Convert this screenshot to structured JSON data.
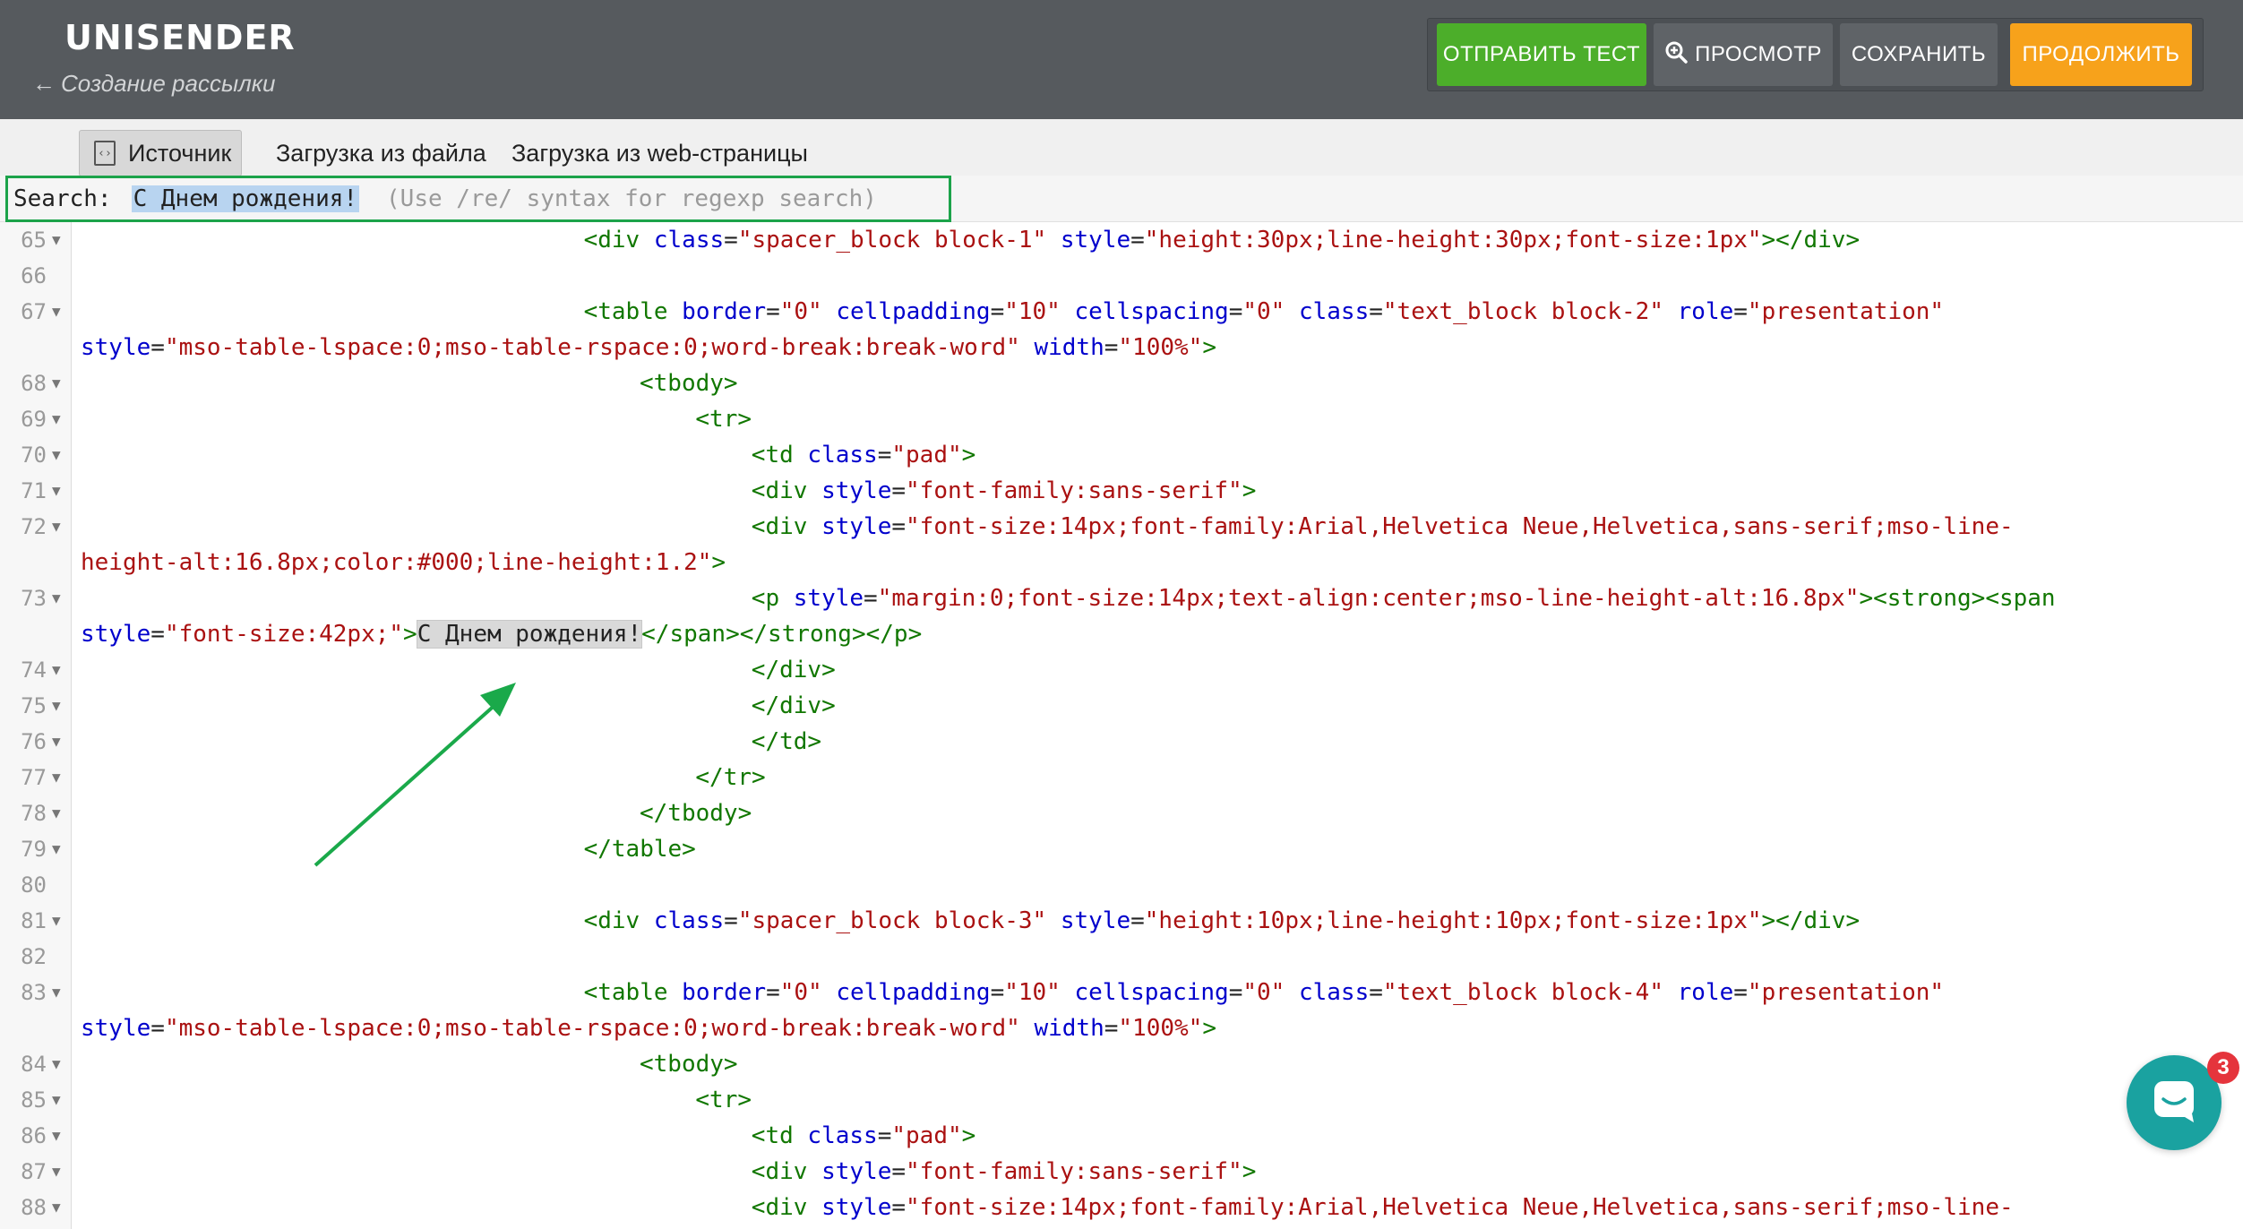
{
  "header": {
    "logo": "UNISENDER",
    "back_arrow": "←",
    "back_label": "Создание рассылки",
    "buttons": {
      "send_test": "ОТПРАВИТЬ ТЕСТ",
      "preview": "ПРОСМОТР",
      "save": "СОХРАНИТЬ",
      "continue": "ПРОДОЛЖИТЬ"
    }
  },
  "tabs": {
    "source": "Источник",
    "from_file": "Загрузка из файла",
    "from_web": "Загрузка из web-страницы"
  },
  "search": {
    "label": "Search:",
    "value": "С Днем рождения!",
    "hint": "(Use /re/ syntax for regexp search)"
  },
  "editor": {
    "lines": [
      {
        "n": "65",
        "fold": true,
        "indent": 36,
        "tokens": [
          [
            "tg",
            "<div "
          ],
          [
            "at",
            "class"
          ],
          [
            "pl",
            "="
          ],
          [
            "st",
            "\"spacer_block block-1\""
          ],
          [
            "pl",
            " "
          ],
          [
            "at",
            "style"
          ],
          [
            "pl",
            "="
          ],
          [
            "st",
            "\"height:30px;line-height:30px;font-size:1px\""
          ],
          [
            "tg",
            "></div>"
          ]
        ]
      },
      {
        "n": "66",
        "fold": false,
        "indent": 0,
        "tokens": []
      },
      {
        "n": "67",
        "fold": true,
        "indent": 36,
        "tokens": [
          [
            "tg",
            "<table "
          ],
          [
            "at",
            "border"
          ],
          [
            "pl",
            "="
          ],
          [
            "st",
            "\"0\""
          ],
          [
            "pl",
            " "
          ],
          [
            "at",
            "cellpadding"
          ],
          [
            "pl",
            "="
          ],
          [
            "st",
            "\"10\""
          ],
          [
            "pl",
            " "
          ],
          [
            "at",
            "cellspacing"
          ],
          [
            "pl",
            "="
          ],
          [
            "st",
            "\"0\""
          ],
          [
            "pl",
            " "
          ],
          [
            "at",
            "class"
          ],
          [
            "pl",
            "="
          ],
          [
            "st",
            "\"text_block block-2\""
          ],
          [
            "pl",
            " "
          ],
          [
            "at",
            "role"
          ],
          [
            "pl",
            "="
          ],
          [
            "st",
            "\"presentation\""
          ]
        ]
      },
      {
        "n": "",
        "fold": false,
        "indent": 0,
        "tokens": [
          [
            "at",
            "style"
          ],
          [
            "pl",
            "="
          ],
          [
            "st",
            "\"mso-table-lspace:0;mso-table-rspace:0;word-break:break-word\""
          ],
          [
            "pl",
            " "
          ],
          [
            "at",
            "width"
          ],
          [
            "pl",
            "="
          ],
          [
            "st",
            "\"100%\""
          ],
          [
            "tg",
            ">"
          ]
        ]
      },
      {
        "n": "68",
        "fold": true,
        "indent": 40,
        "tokens": [
          [
            "tg",
            "<tbody>"
          ]
        ]
      },
      {
        "n": "69",
        "fold": true,
        "indent": 44,
        "tokens": [
          [
            "tg",
            "<tr>"
          ]
        ]
      },
      {
        "n": "70",
        "fold": true,
        "indent": 48,
        "tokens": [
          [
            "tg",
            "<td "
          ],
          [
            "at",
            "class"
          ],
          [
            "pl",
            "="
          ],
          [
            "st",
            "\"pad\""
          ],
          [
            "tg",
            ">"
          ]
        ]
      },
      {
        "n": "71",
        "fold": true,
        "indent": 48,
        "tokens": [
          [
            "tg",
            "<div "
          ],
          [
            "at",
            "style"
          ],
          [
            "pl",
            "="
          ],
          [
            "st",
            "\"font-family:sans-serif\""
          ],
          [
            "tg",
            ">"
          ]
        ]
      },
      {
        "n": "72",
        "fold": true,
        "indent": 48,
        "tokens": [
          [
            "tg",
            "<div "
          ],
          [
            "at",
            "style"
          ],
          [
            "pl",
            "="
          ],
          [
            "st",
            "\"font-size:14px;font-family:Arial,Helvetica Neue,Helvetica,sans-serif;mso-line-"
          ]
        ]
      },
      {
        "n": "",
        "fold": false,
        "indent": 0,
        "tokens": [
          [
            "st",
            "height-alt:16.8px;color:#000;line-height:1.2\""
          ],
          [
            "tg",
            ">"
          ]
        ]
      },
      {
        "n": "73",
        "fold": true,
        "indent": 48,
        "tokens": [
          [
            "tg",
            "<p "
          ],
          [
            "at",
            "style"
          ],
          [
            "pl",
            "="
          ],
          [
            "st",
            "\"margin:0;font-size:14px;text-align:center;mso-line-height-alt:16.8px\""
          ],
          [
            "tg",
            "><strong><span"
          ]
        ]
      },
      {
        "n": "",
        "fold": false,
        "indent": 0,
        "tokens": [
          [
            "at",
            "style"
          ],
          [
            "pl",
            "="
          ],
          [
            "st",
            "\"font-size:42px;\""
          ],
          [
            "tg",
            ">"
          ],
          [
            "hl",
            "С Днем рождения!"
          ],
          [
            "tg",
            "</span></strong></p>"
          ]
        ]
      },
      {
        "n": "74",
        "fold": true,
        "indent": 48,
        "tokens": [
          [
            "tg",
            "</div>"
          ]
        ]
      },
      {
        "n": "75",
        "fold": true,
        "indent": 48,
        "tokens": [
          [
            "tg",
            "</div>"
          ]
        ]
      },
      {
        "n": "76",
        "fold": true,
        "indent": 48,
        "tokens": [
          [
            "tg",
            "</td>"
          ]
        ]
      },
      {
        "n": "77",
        "fold": true,
        "indent": 44,
        "tokens": [
          [
            "tg",
            "</tr>"
          ]
        ]
      },
      {
        "n": "78",
        "fold": true,
        "indent": 40,
        "tokens": [
          [
            "tg",
            "</tbody>"
          ]
        ]
      },
      {
        "n": "79",
        "fold": true,
        "indent": 36,
        "tokens": [
          [
            "tg",
            "</table>"
          ]
        ]
      },
      {
        "n": "80",
        "fold": false,
        "indent": 0,
        "tokens": []
      },
      {
        "n": "81",
        "fold": true,
        "indent": 36,
        "tokens": [
          [
            "tg",
            "<div "
          ],
          [
            "at",
            "class"
          ],
          [
            "pl",
            "="
          ],
          [
            "st",
            "\"spacer_block block-3\""
          ],
          [
            "pl",
            " "
          ],
          [
            "at",
            "style"
          ],
          [
            "pl",
            "="
          ],
          [
            "st",
            "\"height:10px;line-height:10px;font-size:1px\""
          ],
          [
            "tg",
            "></div>"
          ]
        ]
      },
      {
        "n": "82",
        "fold": false,
        "indent": 0,
        "tokens": []
      },
      {
        "n": "83",
        "fold": true,
        "indent": 36,
        "tokens": [
          [
            "tg",
            "<table "
          ],
          [
            "at",
            "border"
          ],
          [
            "pl",
            "="
          ],
          [
            "st",
            "\"0\""
          ],
          [
            "pl",
            " "
          ],
          [
            "at",
            "cellpadding"
          ],
          [
            "pl",
            "="
          ],
          [
            "st",
            "\"10\""
          ],
          [
            "pl",
            " "
          ],
          [
            "at",
            "cellspacing"
          ],
          [
            "pl",
            "="
          ],
          [
            "st",
            "\"0\""
          ],
          [
            "pl",
            " "
          ],
          [
            "at",
            "class"
          ],
          [
            "pl",
            "="
          ],
          [
            "st",
            "\"text_block block-4\""
          ],
          [
            "pl",
            " "
          ],
          [
            "at",
            "role"
          ],
          [
            "pl",
            "="
          ],
          [
            "st",
            "\"presentation\""
          ]
        ]
      },
      {
        "n": "",
        "fold": false,
        "indent": 0,
        "tokens": [
          [
            "at",
            "style"
          ],
          [
            "pl",
            "="
          ],
          [
            "st",
            "\"mso-table-lspace:0;mso-table-rspace:0;word-break:break-word\""
          ],
          [
            "pl",
            " "
          ],
          [
            "at",
            "width"
          ],
          [
            "pl",
            "="
          ],
          [
            "st",
            "\"100%\""
          ],
          [
            "tg",
            ">"
          ]
        ]
      },
      {
        "n": "84",
        "fold": true,
        "indent": 40,
        "tokens": [
          [
            "tg",
            "<tbody>"
          ]
        ]
      },
      {
        "n": "85",
        "fold": true,
        "indent": 44,
        "tokens": [
          [
            "tg",
            "<tr>"
          ]
        ]
      },
      {
        "n": "86",
        "fold": true,
        "indent": 48,
        "tokens": [
          [
            "tg",
            "<td "
          ],
          [
            "at",
            "class"
          ],
          [
            "pl",
            "="
          ],
          [
            "st",
            "\"pad\""
          ],
          [
            "tg",
            ">"
          ]
        ]
      },
      {
        "n": "87",
        "fold": true,
        "indent": 48,
        "tokens": [
          [
            "tg",
            "<div "
          ],
          [
            "at",
            "style"
          ],
          [
            "pl",
            "="
          ],
          [
            "st",
            "\"font-family:sans-serif\""
          ],
          [
            "tg",
            ">"
          ]
        ]
      },
      {
        "n": "88",
        "fold": true,
        "indent": 48,
        "tokens": [
          [
            "tg",
            "<div "
          ],
          [
            "at",
            "style"
          ],
          [
            "pl",
            "="
          ],
          [
            "st",
            "\"font-size:14px;font-family:Arial,Helvetica Neue,Helvetica,sans-serif;mso-line-"
          ]
        ]
      }
    ]
  },
  "chat": {
    "badge_count": "3"
  },
  "colors": {
    "header_bg": "#565a5e",
    "send_test": "#4cae2a",
    "continue": "#f7a21b",
    "search_outline": "#1ca34a",
    "annotation_arrow": "#1aa94a",
    "chat": "#1aa2a0"
  }
}
